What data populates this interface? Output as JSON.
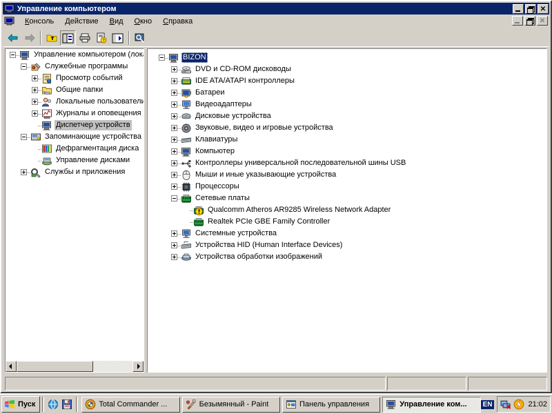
{
  "window": {
    "title": "Управление компьютером",
    "icon": "computer-icon",
    "buttons": {
      "minimize": "_",
      "maximize": "□",
      "close": "✕"
    }
  },
  "menubar": {
    "icon": "computer-icon",
    "items": [
      {
        "label": "Консоль",
        "accel": "К"
      },
      {
        "label": "Действие",
        "accel": "Д"
      },
      {
        "label": "Вид",
        "accel": "В"
      },
      {
        "label": "Окно",
        "accel": "О"
      },
      {
        "label": "Справка",
        "accel": "С"
      }
    ],
    "child_buttons": {
      "minimize": "_",
      "restore": "□",
      "close": "✕"
    }
  },
  "toolbar": {
    "buttons": [
      {
        "name": "back-button",
        "icon": "arrow-left-icon",
        "enabled": true
      },
      {
        "name": "forward-button",
        "icon": "arrow-right-icon",
        "enabled": false
      },
      {
        "name": "up-one-level-button",
        "icon": "folder-up-icon",
        "enabled": true
      },
      {
        "name": "show-hide-tree-button",
        "icon": "tree-pane-icon",
        "pressed": true
      },
      {
        "name": "print-button",
        "icon": "printer-icon",
        "enabled": true
      },
      {
        "name": "properties-button",
        "icon": "properties-icon",
        "enabled": true
      },
      {
        "name": "refresh-scan-button",
        "icon": "scan-hardware-icon",
        "enabled": true
      },
      {
        "name": "help-button",
        "icon": "help-magnifier-icon",
        "enabled": true
      }
    ]
  },
  "left_tree": {
    "nodes": [
      {
        "label": "Управление компьютером (локальным)",
        "icon": "computer-icon",
        "indent": 0,
        "expander": "minus",
        "selected": false
      },
      {
        "label": "Служебные программы",
        "icon": "utilities-icon",
        "indent": 1,
        "expander": "minus",
        "selected": false
      },
      {
        "label": "Просмотр событий",
        "icon": "event-viewer-icon",
        "indent": 2,
        "expander": "plus",
        "selected": false
      },
      {
        "label": "Общие папки",
        "icon": "shared-folders-icon",
        "indent": 2,
        "expander": "plus",
        "selected": false
      },
      {
        "label": "Локальные пользователи и группы",
        "icon": "local-users-icon",
        "indent": 2,
        "expander": "plus",
        "selected": false
      },
      {
        "label": "Журналы и оповещения производительности",
        "icon": "perf-logs-icon",
        "indent": 2,
        "expander": "plus",
        "selected": false
      },
      {
        "label": "Диспетчер устройств",
        "icon": "device-manager-icon",
        "indent": 2,
        "expander": "none",
        "selected": true
      },
      {
        "label": "Запоминающие устройства",
        "icon": "storage-icon",
        "indent": 1,
        "expander": "minus",
        "selected": false
      },
      {
        "label": "Дефрагментация диска",
        "icon": "defrag-icon",
        "indent": 2,
        "expander": "none",
        "selected": false
      },
      {
        "label": "Управление дисками",
        "icon": "disk-management-icon",
        "indent": 2,
        "expander": "none",
        "selected": false
      },
      {
        "label": "Службы и приложения",
        "icon": "services-apps-icon",
        "indent": 1,
        "expander": "plus",
        "selected": false
      }
    ]
  },
  "device_tree": {
    "nodes": [
      {
        "label": "BIZON",
        "icon": "computer-node-icon",
        "indent": 0,
        "expander": "minus",
        "selected": true,
        "warning": false
      },
      {
        "label": "DVD и CD-ROM дисководы",
        "icon": "cdrom-icon",
        "indent": 1,
        "expander": "plus",
        "selected": false,
        "warning": false
      },
      {
        "label": "IDE ATA/ATAPI контроллеры",
        "icon": "ide-controller-icon",
        "indent": 1,
        "expander": "plus",
        "selected": false,
        "warning": false
      },
      {
        "label": "Батареи",
        "icon": "battery-icon",
        "indent": 1,
        "expander": "plus",
        "selected": false,
        "warning": false
      },
      {
        "label": "Видеоадаптеры",
        "icon": "display-adapter-icon",
        "indent": 1,
        "expander": "plus",
        "selected": false,
        "warning": false
      },
      {
        "label": "Дисковые устройства",
        "icon": "disk-drive-icon",
        "indent": 1,
        "expander": "plus",
        "selected": false,
        "warning": false
      },
      {
        "label": "Звуковые, видео и игровые устройства",
        "icon": "sound-device-icon",
        "indent": 1,
        "expander": "plus",
        "selected": false,
        "warning": false
      },
      {
        "label": "Клавиатуры",
        "icon": "keyboard-icon",
        "indent": 1,
        "expander": "plus",
        "selected": false,
        "warning": false
      },
      {
        "label": "Компьютер",
        "icon": "computer-device-icon",
        "indent": 1,
        "expander": "plus",
        "selected": false,
        "warning": false
      },
      {
        "label": "Контроллеры универсальной последовательной шины USB",
        "icon": "usb-controller-icon",
        "indent": 1,
        "expander": "plus",
        "selected": false,
        "warning": false
      },
      {
        "label": "Мыши и иные указывающие устройства",
        "icon": "mouse-icon",
        "indent": 1,
        "expander": "plus",
        "selected": false,
        "warning": false
      },
      {
        "label": "Процессоры",
        "icon": "processor-icon",
        "indent": 1,
        "expander": "plus",
        "selected": false,
        "warning": false
      },
      {
        "label": "Сетевые платы",
        "icon": "network-adapter-icon",
        "indent": 1,
        "expander": "minus",
        "selected": false,
        "warning": false
      },
      {
        "label": "Qualcomm Atheros AR9285 Wireless Network Adapter",
        "icon": "network-adapter-icon",
        "indent": 2,
        "expander": "none",
        "selected": false,
        "warning": true
      },
      {
        "label": "Realtek PCIe GBE Family Controller",
        "icon": "network-adapter-icon",
        "indent": 2,
        "expander": "none",
        "selected": false,
        "warning": false
      },
      {
        "label": "Системные устройства",
        "icon": "system-device-icon",
        "indent": 1,
        "expander": "plus",
        "selected": false,
        "warning": false
      },
      {
        "label": "Устройства HID (Human Interface Devices)",
        "icon": "hid-device-icon",
        "indent": 1,
        "expander": "plus",
        "selected": false,
        "warning": false
      },
      {
        "label": "Устройства обработки изображений",
        "icon": "imaging-device-icon",
        "indent": 1,
        "expander": "plus",
        "selected": false,
        "warning": false
      }
    ]
  },
  "statusbar": {
    "pane1": "",
    "pane2": "",
    "pane3": ""
  },
  "taskbar": {
    "start_label": "Пуск",
    "quicklaunch": [
      {
        "name": "quicklaunch-browser",
        "icon": "browser-icon"
      },
      {
        "name": "quicklaunch-save",
        "icon": "floppy-save-icon"
      }
    ],
    "tasks": [
      {
        "label": "Total Commander ...",
        "icon": "total-commander-icon",
        "active": false
      },
      {
        "label": "Безымянный - Paint",
        "icon": "paint-icon",
        "active": false
      },
      {
        "label": "Панель управления",
        "icon": "control-panel-icon",
        "active": false
      },
      {
        "label": "Управление ком...",
        "icon": "computer-icon",
        "active": true
      }
    ],
    "language": "EN",
    "tray": [
      {
        "name": "network-disconnected-icon"
      },
      {
        "name": "power-icon"
      }
    ],
    "clock": "21:02"
  },
  "colors": {
    "titlebar": "#0a246a",
    "face": "#d4d0c8",
    "selection_blue": "#0a246a",
    "selection_gray": "#c0c0c0",
    "warning_yellow": "#ffd800"
  }
}
